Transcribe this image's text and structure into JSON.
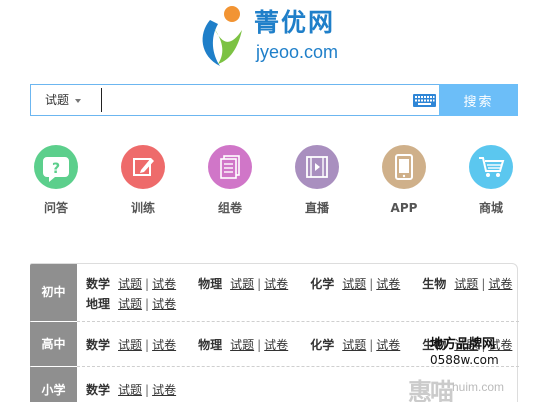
{
  "logo": {
    "name_cn": "菁优网",
    "domain": "jyeoo.com"
  },
  "search": {
    "type_label": "试题",
    "placeholder": "",
    "value": "",
    "button_label": "搜索"
  },
  "nav": [
    {
      "label": "问答",
      "icon": "question-icon",
      "color": "#5ccf8c"
    },
    {
      "label": "训练",
      "icon": "pencil-edit-icon",
      "color": "#ee6b6b"
    },
    {
      "label": "组卷",
      "icon": "paper-stack-icon",
      "color": "#d076c8"
    },
    {
      "label": "直播",
      "icon": "film-play-icon",
      "color": "#a98fbf"
    },
    {
      "label": "APP",
      "icon": "tablet-icon",
      "color": "#cfb08a"
    },
    {
      "label": "商城",
      "icon": "shopping-cart-icon",
      "color": "#5bc7ef"
    }
  ],
  "levels": [
    {
      "name": "初中",
      "lines": [
        [
          {
            "subject": "数学",
            "links": [
              "试题",
              "试卷"
            ]
          },
          {
            "subject": "物理",
            "links": [
              "试题",
              "试卷"
            ]
          },
          {
            "subject": "化学",
            "links": [
              "试题",
              "试卷"
            ]
          },
          {
            "subject": "生物",
            "links": [
              "试题",
              "试卷"
            ]
          }
        ],
        [
          {
            "subject": "地理",
            "links": [
              "试题",
              "试卷"
            ]
          }
        ]
      ]
    },
    {
      "name": "高中",
      "lines": [
        [
          {
            "subject": "数学",
            "links": [
              "试题",
              "试卷"
            ]
          },
          {
            "subject": "物理",
            "links": [
              "试题",
              "试卷"
            ]
          },
          {
            "subject": "化学",
            "links": [
              "试题",
              "试卷"
            ]
          },
          {
            "subject": "生物",
            "links": [
              "试题",
              "试卷"
            ]
          }
        ]
      ]
    },
    {
      "name": "小学",
      "lines": [
        [
          {
            "subject": "数学",
            "links": [
              "试题",
              "试卷"
            ]
          }
        ]
      ]
    }
  ],
  "watermarks": {
    "line1": "地方品牌网",
    "line2": "0588w.com",
    "line3_cn": "惠喵",
    "line3_en": "huim.com"
  },
  "colors": {
    "brand_blue": "#1f7fc9",
    "brand_orange": "#f29433",
    "brand_green": "#7cc243",
    "search_button": "#6cbef8",
    "level_bg": "#8f8f8f"
  }
}
